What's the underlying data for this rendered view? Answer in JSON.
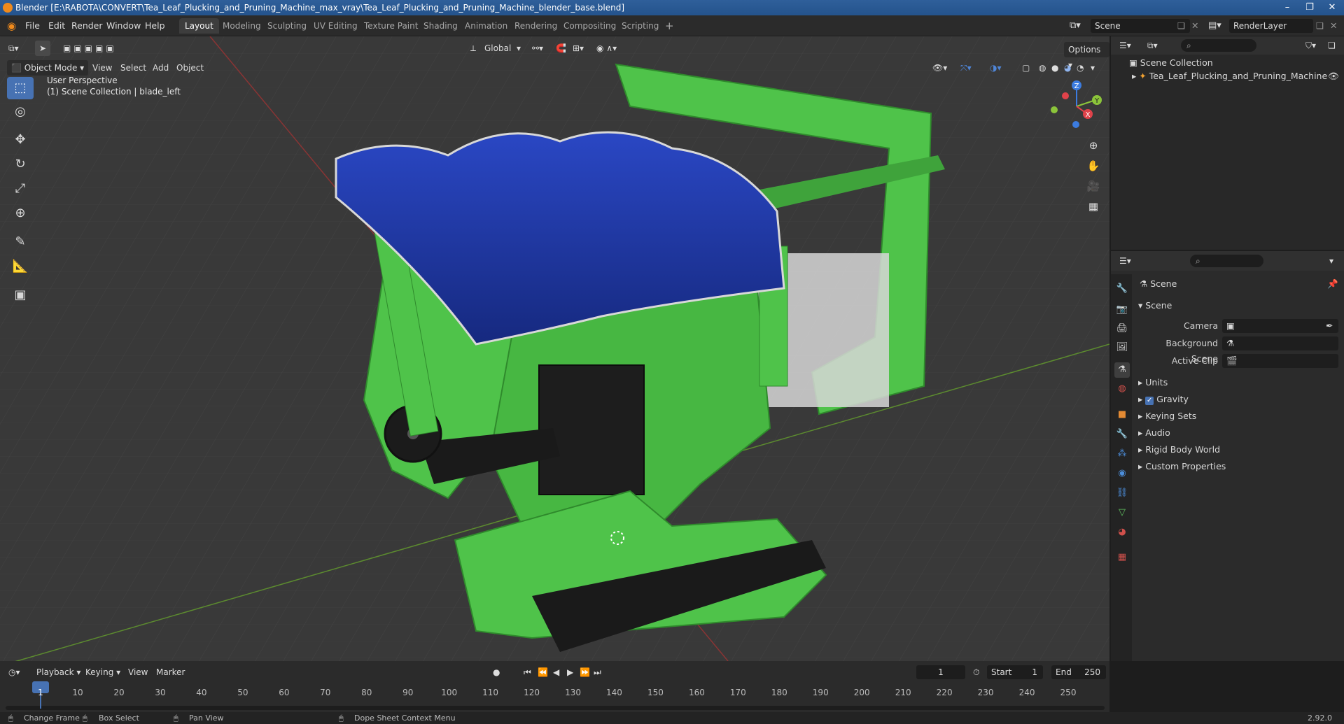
{
  "title": "Blender [E:\\RABOTA\\CONVERT\\Tea_Leaf_Plucking_and_Pruning_Machine_max_vray\\Tea_Leaf_Plucking_and_Pruning_Machine_blender_base.blend]",
  "menu": [
    "File",
    "Edit",
    "Render",
    "Window",
    "Help"
  ],
  "workspaces": [
    "Layout",
    "Modeling",
    "Sculpting",
    "UV Editing",
    "Texture Paint",
    "Shading",
    "Animation",
    "Rendering",
    "Compositing",
    "Scripting"
  ],
  "active_workspace": "Layout",
  "scene_name": "Scene",
  "render_layer": "RenderLayer",
  "viewport": {
    "mode": "Object Mode",
    "menus": [
      "View",
      "Select",
      "Add",
      "Object"
    ],
    "transform_orientation": "Global",
    "options_label": "Options",
    "overlay_line1": "User Perspective",
    "overlay_line2": "(1) Scene Collection | blade_left",
    "gizmo": {
      "x": "X",
      "y": "Y",
      "z": "Z"
    }
  },
  "outliner": {
    "root": "Scene Collection",
    "items": [
      {
        "label": "Tea_Leaf_Plucking_and_Pruning_Machine"
      }
    ]
  },
  "properties": {
    "header": "Scene",
    "panel": "Scene",
    "fields": [
      {
        "label": "Camera"
      },
      {
        "label": "Background Scene"
      },
      {
        "label": "Active Clip"
      }
    ],
    "sections": [
      "Units",
      "Gravity",
      "Keying Sets",
      "Audio",
      "Rigid Body World",
      "Custom Properties"
    ],
    "gravity_checked": true
  },
  "timeline": {
    "menus": [
      "Playback",
      "Keying",
      "View",
      "Marker"
    ],
    "current_frame": "1",
    "start_label": "Start",
    "start": "1",
    "end_label": "End",
    "end": "250",
    "ticks": [
      "1",
      "10",
      "20",
      "30",
      "40",
      "50",
      "60",
      "70",
      "80",
      "90",
      "100",
      "110",
      "120",
      "130",
      "140",
      "150",
      "160",
      "170",
      "180",
      "190",
      "200",
      "210",
      "220",
      "230",
      "240",
      "250"
    ]
  },
  "statusbar": {
    "items": [
      "Change Frame",
      "Box Select",
      "Pan View",
      "Dope Sheet Context Menu"
    ],
    "version": "2.92.0"
  },
  "colors": {
    "accent": "#4772b3",
    "machine_green": "#4fc34a",
    "canopy_blue": "#1f3aa8",
    "grid_bg": "#3a3a3a"
  }
}
